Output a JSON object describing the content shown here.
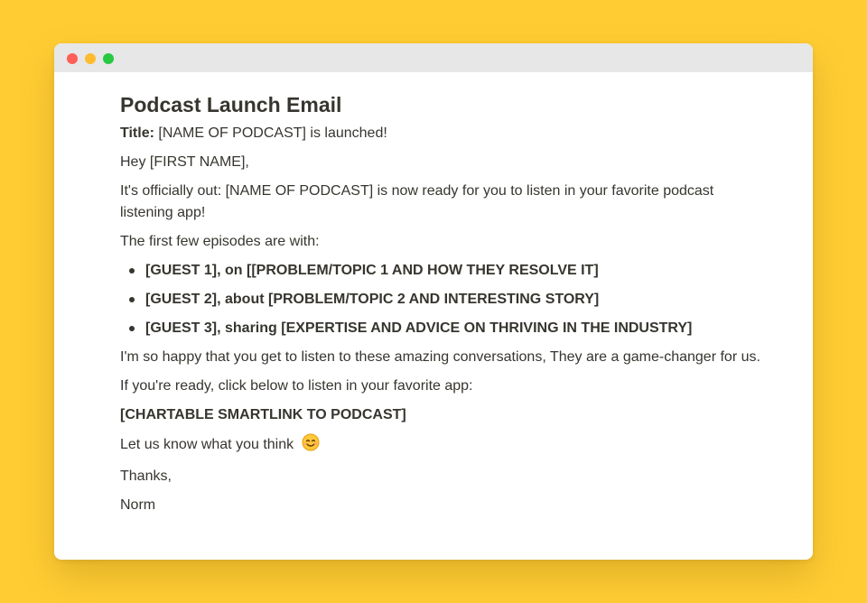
{
  "window": {
    "controls": [
      "close",
      "minimize",
      "zoom"
    ]
  },
  "doc": {
    "heading": "Podcast Launch Email",
    "title_label": "Title:",
    "title_value": " [NAME OF PODCAST] is launched!",
    "greeting": "Hey [FIRST NAME],",
    "intro": "It's officially out: [NAME OF PODCAST] is now ready for you to listen in your favorite podcast listening app!",
    "episodes_intro": "The first few episodes are with:",
    "bullets": [
      "[GUEST 1], on [[PROBLEM/TOPIC 1 AND HOW THEY RESOLVE IT]",
      "[GUEST 2], about [PROBLEM/TOPIC 2 AND INTERESTING STORY]",
      "[GUEST 3], sharing [EXPERTISE AND ADVICE ON THRIVING IN THE INDUSTRY]"
    ],
    "happy": "I'm so happy that you get to listen to these amazing conversations, They are a game-changer for us.",
    "ready": "If you're ready, click below to listen in your favorite app:",
    "smartlink": "[CHARTABLE SMARTLINK TO PODCAST]",
    "feedback": "Let us know what you think",
    "feedback_emoji": "smiling-face-emoji",
    "thanks": "Thanks,",
    "signature": "Norm"
  },
  "colors": {
    "background": "#FFCD33",
    "close": "#FE5F57",
    "minimize": "#FEBC2E",
    "zoom": "#28C840",
    "text": "#37352F"
  }
}
